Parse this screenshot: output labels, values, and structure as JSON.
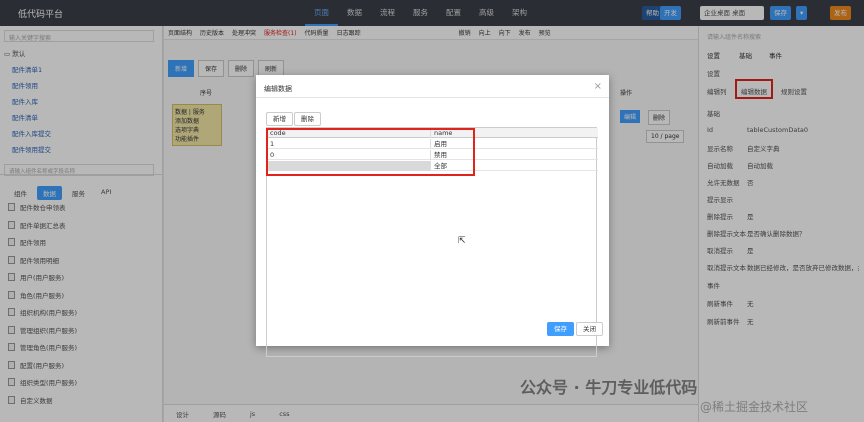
{
  "app": {
    "title": "低代码平台"
  },
  "top_nav": [
    "页面",
    "数据",
    "流程",
    "服务",
    "配置",
    "高级",
    "架构"
  ],
  "top_right": {
    "enterprise_placeholder": "企业桌面 桌面",
    "save": "保存",
    "publish": "发布",
    "btn_more": "帮助",
    "btn_badge": "开发"
  },
  "left_panel": {
    "search_placeholder": "输入关键字搜索",
    "tree_root": "默认",
    "tree_items": [
      "配件清单1",
      "配件领用",
      "配件入库",
      "配件清单",
      "配件入库提交",
      "配件领用提交"
    ],
    "component_search_placeholder": "请输入组件名称或字段名称",
    "tabs": [
      "组件",
      "数据",
      "服务",
      "API"
    ],
    "components": [
      "配件数仓申领表",
      "配件单据汇总表",
      "配件领用",
      "配件领用明细",
      "用户(用户服务)",
      "角色(用户服务)",
      "组织机构(用户服务)",
      "管理组织(用户服务)",
      "管理角色(用户服务)",
      "配置(用户服务)",
      "组织类型(用户服务)",
      "自定义数据"
    ]
  },
  "toolbar": {
    "items": [
      "页面结构",
      "历史版本",
      "处理冲突",
      "服务检查(1)",
      "代码质量",
      "日志跟踪",
      "撤销",
      "向上",
      "向下",
      "发布",
      "预览"
    ],
    "red_item": "服务检查(1)"
  },
  "canvas": {
    "buttons": [
      "新增",
      "保存",
      "删除",
      "刷新"
    ],
    "search_placeholder": "搜索",
    "col_index": "序号",
    "col_op": "操作",
    "op_edit": "编辑",
    "op_delete": "删除",
    "pager": "10 / page",
    "tree_nodes": [
      "数据 | 服务",
      "添加数据",
      "选项字典",
      "功能插件"
    ]
  },
  "dialog": {
    "title": "编辑数据",
    "add_btn": "新增",
    "delete_btn": "删除",
    "columns": [
      "code",
      "name"
    ],
    "rows": [
      {
        "code": "1",
        "name": "启用"
      },
      {
        "code": "0",
        "name": "禁用"
      },
      {
        "code": "",
        "name": "全部"
      }
    ],
    "save_btn": "保存",
    "close_btn": "关闭"
  },
  "right_panel": {
    "search_placeholder": "请输入组件名称搜索",
    "tabs": [
      "设置",
      "基础",
      "事件"
    ],
    "section_settings": "设置",
    "btn_edit_data": "编辑数据",
    "btn_rule": "规则设置",
    "btn_edit_col": "编辑列",
    "section_basic": "基础",
    "props": [
      {
        "label": "Id",
        "value": "tableCustomData0"
      },
      {
        "label": "显示名称",
        "value": "自定义字典"
      },
      {
        "label": "自动加载",
        "value": "自动加载"
      },
      {
        "label": "允许无数据",
        "value": "否"
      },
      {
        "label": "提示显示",
        "value": ""
      },
      {
        "label": "删除提示",
        "value": "是"
      },
      {
        "label": "删除提示文本",
        "value": "是否确认删除数据？"
      },
      {
        "label": "取消提示",
        "value": "是"
      },
      {
        "label": "取消提示文本",
        "value": "数据已经修改，是否放弃已修改数据，并关闭..."
      }
    ],
    "section_event": "事件",
    "events": [
      {
        "label": "刷新事件",
        "value": "无"
      },
      {
        "label": "刷新前事件",
        "value": "无"
      }
    ]
  },
  "bottom_tabs": [
    "设计",
    "源码",
    "js",
    "css"
  ],
  "watermark": "公众号 · 牛刀专业低代码",
  "watermark2": "@稀土掘金技术社区"
}
